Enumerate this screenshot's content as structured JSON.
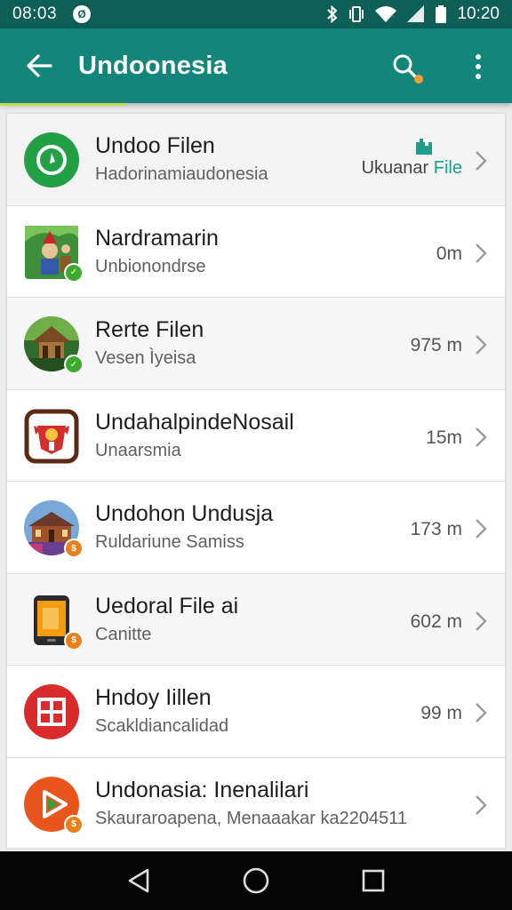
{
  "status_bar": {
    "time_left": "08:03",
    "time_right": "10:20",
    "data_saver_glyph": "Ø",
    "icons": [
      "bluetooth-icon",
      "vibrate-icon",
      "wifi-icon",
      "signal-icon",
      "battery-icon"
    ]
  },
  "app_bar": {
    "title": "Undoonesia",
    "icons": [
      "back-arrow-icon",
      "search-icon",
      "more-vert-icon"
    ],
    "accent_color": "#14857b",
    "status_color": "#0e5f58"
  },
  "items": [
    {
      "title": "Undoo Filen",
      "subtitle": "Hadorinamiaudonesia",
      "meta_label": "Ukuanar",
      "meta_file": "File",
      "icon": "green-circle-app-icon"
    },
    {
      "title": "Nardramarin",
      "subtitle": "Unbionondrse",
      "size": "0m",
      "icon": "illustration-app-icon"
    },
    {
      "title": "Rerte Filen",
      "subtitle": "Vesen Ìyeisa",
      "size": "975 m",
      "icon": "hut-photo-app-icon"
    },
    {
      "title": "UndahalpindeNosail",
      "subtitle": "Unaarsmia",
      "size": "15m",
      "icon": "red-emblem-app-icon"
    },
    {
      "title": "Undohon Undusja",
      "subtitle": "Ruldariune Samiss",
      "size": "173 m",
      "icon": "building-photo-app-icon"
    },
    {
      "title": "Uedoral File ai",
      "subtitle": "Canitte",
      "size": "602 m",
      "icon": "phone-file-app-icon"
    },
    {
      "title": "Hndoy Iillen",
      "subtitle": "Scakldiancalidad",
      "size": "99 m",
      "icon": "red-grid-app-icon"
    },
    {
      "title": "Undonasia: Inenalilari",
      "subtitle": "Skauraroapena, Menaaakar ka2204511",
      "icon": "play-app-icon"
    }
  ],
  "nav_bar": {
    "icons": [
      "back-triangle-icon",
      "home-circle-icon",
      "recents-square-icon"
    ]
  }
}
